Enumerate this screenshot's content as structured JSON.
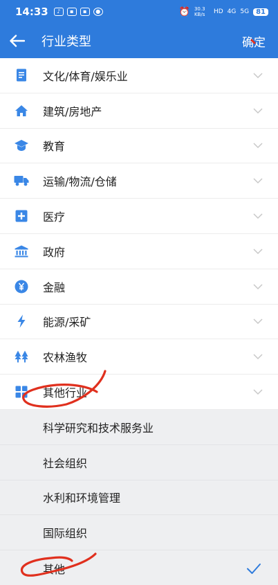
{
  "status": {
    "time": "14:33",
    "net_speed": "30.3 KB/s",
    "hd": "HD",
    "signal1": "4G",
    "signal2": "5G",
    "battery": "81"
  },
  "header": {
    "title": "行业类型",
    "confirm": "确定"
  },
  "industries": [
    {
      "label": "文化/体育/娱乐业",
      "icon": "document-icon"
    },
    {
      "label": "建筑/房地产",
      "icon": "house-icon"
    },
    {
      "label": "教育",
      "icon": "graduation-cap-icon"
    },
    {
      "label": "运输/物流/仓储",
      "icon": "truck-icon"
    },
    {
      "label": "医疗",
      "icon": "medical-cross-icon"
    },
    {
      "label": "政府",
      "icon": "government-building-icon"
    },
    {
      "label": "金融",
      "icon": "yen-coin-icon"
    },
    {
      "label": "能源/采矿",
      "icon": "lightning-icon"
    },
    {
      "label": "农林渔牧",
      "icon": "trees-icon"
    },
    {
      "label": "其他行业",
      "icon": "grid-icon"
    }
  ],
  "sub_items": [
    {
      "label": "科学研究和技术服务业",
      "selected": false
    },
    {
      "label": "社会组织",
      "selected": false
    },
    {
      "label": "水利和环境管理",
      "selected": false
    },
    {
      "label": "国际组织",
      "selected": false
    },
    {
      "label": "其他",
      "selected": true
    }
  ],
  "colors": {
    "accent": "#2e7bdc",
    "annotation": "#e0301e"
  }
}
